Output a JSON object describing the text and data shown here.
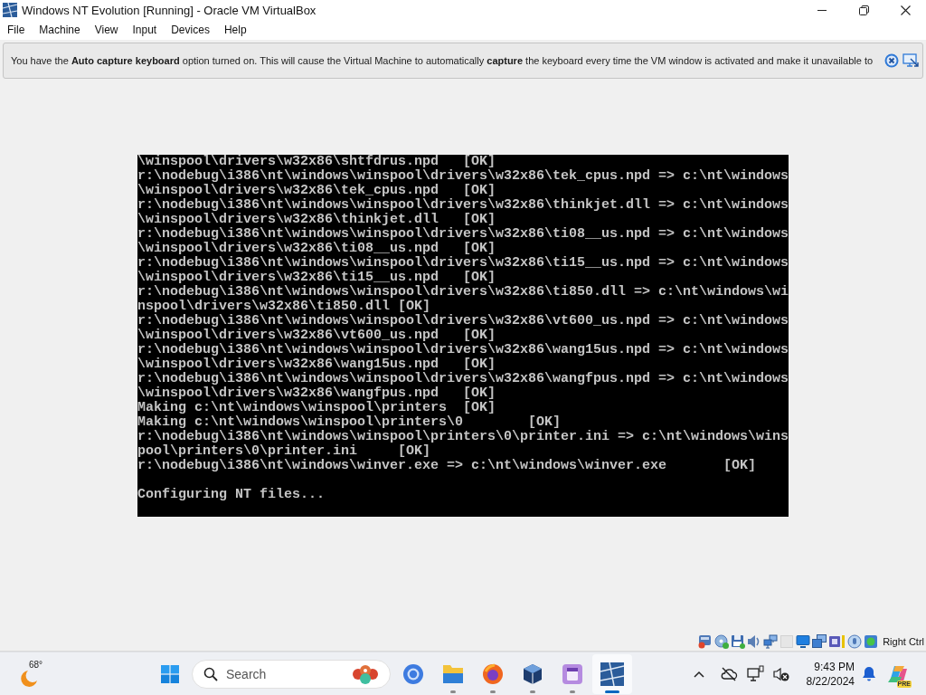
{
  "window": {
    "title": "Windows NT Evolution [Running] - Oracle VM VirtualBox"
  },
  "menu": [
    "File",
    "Machine",
    "View",
    "Input",
    "Devices",
    "Help"
  ],
  "notice": {
    "text": "You have the **Auto capture keyboard** option turned on. This will cause the Virtual Machine to automatically **capture** the keyboard every time the VM window is activated and make it unavailable to"
  },
  "console": {
    "lines": [
      "\\winspool\\drivers\\w32x86\\shtfdrus.npd   [OK]",
      "r:\\nodebug\\i386\\nt\\windows\\winspool\\drivers\\w32x86\\tek_cpus.npd => c:\\nt\\windows",
      "\\winspool\\drivers\\w32x86\\tek_cpus.npd   [OK]",
      "r:\\nodebug\\i386\\nt\\windows\\winspool\\drivers\\w32x86\\thinkjet.dll => c:\\nt\\windows",
      "\\winspool\\drivers\\w32x86\\thinkjet.dll   [OK]",
      "r:\\nodebug\\i386\\nt\\windows\\winspool\\drivers\\w32x86\\ti08__us.npd => c:\\nt\\windows",
      "\\winspool\\drivers\\w32x86\\ti08__us.npd   [OK]",
      "r:\\nodebug\\i386\\nt\\windows\\winspool\\drivers\\w32x86\\ti15__us.npd => c:\\nt\\windows",
      "\\winspool\\drivers\\w32x86\\ti15__us.npd   [OK]",
      "r:\\nodebug\\i386\\nt\\windows\\winspool\\drivers\\w32x86\\ti850.dll => c:\\nt\\windows\\wi",
      "nspool\\drivers\\w32x86\\ti850.dll [OK]",
      "r:\\nodebug\\i386\\nt\\windows\\winspool\\drivers\\w32x86\\vt600_us.npd => c:\\nt\\windows",
      "\\winspool\\drivers\\w32x86\\vt600_us.npd   [OK]",
      "r:\\nodebug\\i386\\nt\\windows\\winspool\\drivers\\w32x86\\wang15us.npd => c:\\nt\\windows",
      "\\winspool\\drivers\\w32x86\\wang15us.npd   [OK]",
      "r:\\nodebug\\i386\\nt\\windows\\winspool\\drivers\\w32x86\\wangfpus.npd => c:\\nt\\windows",
      "\\winspool\\drivers\\w32x86\\wangfpus.npd   [OK]",
      "Making c:\\nt\\windows\\winspool\\printers  [OK]",
      "Making c:\\nt\\windows\\winspool\\printers\\0        [OK]",
      "r:\\nodebug\\i386\\nt\\windows\\winspool\\printers\\0\\printer.ini => c:\\nt\\windows\\wins",
      "pool\\printers\\0\\printer.ini     [OK]",
      "r:\\nodebug\\i386\\nt\\windows\\winver.exe => c:\\nt\\windows\\winver.exe       [OK]"
    ],
    "status": "Configuring NT files..."
  },
  "status_bar": {
    "host_key": "Right Ctrl"
  },
  "taskbar": {
    "weather": "68°",
    "search": {
      "placeholder": "Search"
    },
    "apps": [
      {
        "kind": "ring",
        "running": false,
        "selected": false
      },
      {
        "kind": "folder",
        "running": true,
        "selected": false
      },
      {
        "kind": "browser",
        "running": true,
        "selected": false
      },
      {
        "kind": "cube",
        "running": true,
        "selected": false
      },
      {
        "kind": "notes",
        "running": true,
        "selected": false
      },
      {
        "kind": "tile",
        "running": true,
        "selected": true
      }
    ],
    "time": "9:43 PM",
    "date": "8/22/2024",
    "badge": "PRE"
  }
}
